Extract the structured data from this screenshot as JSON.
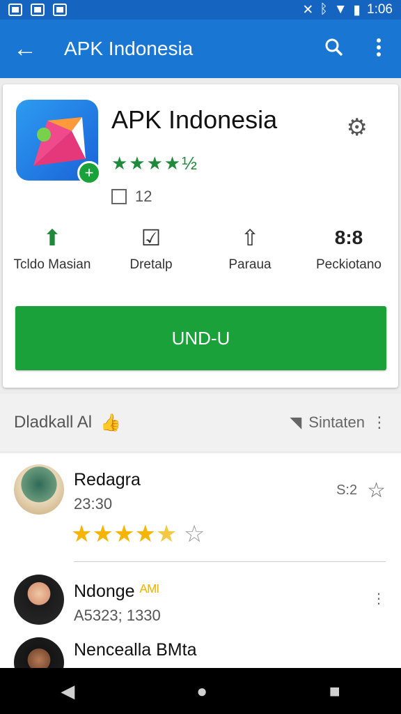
{
  "status": {
    "time": "1:06"
  },
  "appbar": {
    "title": "APK Indonesia",
    "back_icon": "arrow-back-icon",
    "search_icon": "search-icon",
    "menu_icon": "more-vert-icon"
  },
  "app": {
    "name": "APK Indonesia",
    "download_count": "12",
    "rating_stars": "★★★★½",
    "stats": [
      {
        "icon": "download-green-icon",
        "label": "Tcldo Masian"
      },
      {
        "icon": "package-icon",
        "label": "Dretalp"
      },
      {
        "icon": "share-icon",
        "label": "Paraua"
      },
      {
        "value": "8:8",
        "label": "Peckiotano"
      }
    ],
    "install_label": "UND-U"
  },
  "section": {
    "left_label": "Dladkall Al",
    "right_label": "Sintaten"
  },
  "reviews": [
    {
      "name": "Redagra",
      "date": "23:30",
      "meta": "S:2",
      "stars": 4.5
    },
    {
      "name": "Ndonge",
      "badge": "ᴬᴹᴵ",
      "date": "A5323; 1330"
    },
    {
      "name": "Nencealla BMta",
      "date": ""
    }
  ],
  "colors": {
    "primary": "#1976d2",
    "status": "#1565c0",
    "install": "#1aa13a",
    "star": "#f5b400"
  }
}
